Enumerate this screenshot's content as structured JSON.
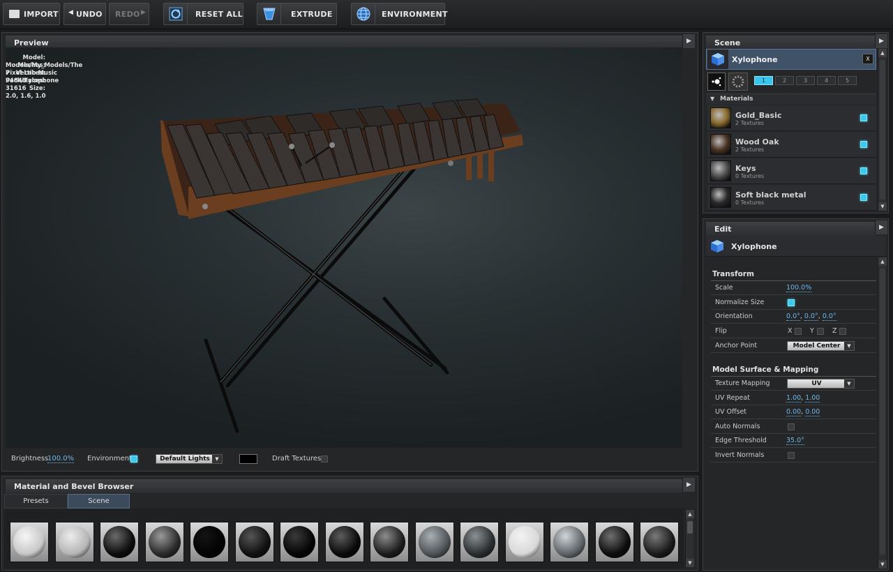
{
  "toolbar": {
    "import": "IMPORT",
    "undo": "UNDO",
    "redo": "REDO",
    "reset_all": "RESET ALL",
    "extrude": "EXTRUDE",
    "environment": "ENVIRONMENT"
  },
  "preview": {
    "title": "Preview",
    "info": [
      {
        "key": "Model:",
        "value": "Models/My_Models/The Pixel Lab Music Pack/Xylophone"
      },
      {
        "key": "Meshes:",
        "value": "7"
      },
      {
        "key": "Vertices:",
        "value": "94848"
      },
      {
        "key": "Faces:",
        "value": "31616"
      },
      {
        "key": "Size:",
        "value": "2.0, 1.6, 1.0"
      }
    ],
    "brightness_label": "Brightness",
    "brightness_value": "100.0%",
    "environment_label": "Environment",
    "environment_checked": true,
    "lights_select": "Default Lights",
    "draft_label": "Draft Textures",
    "draft_checked": false
  },
  "browser": {
    "title": "Material and Bevel Browser",
    "tabs": [
      "Presets",
      "Scene"
    ],
    "active_tab": "Scene",
    "swatches": [
      {
        "name": "swatch-1",
        "base": "#c8c8c8",
        "hi": "#f6f6f6"
      },
      {
        "name": "swatch-2",
        "base": "#b5b5b5",
        "hi": "#ececec"
      },
      {
        "name": "swatch-3",
        "base": "#0c0c0c",
        "hi": "#6a6a6a"
      },
      {
        "name": "swatch-4",
        "base": "#2a2a2a",
        "hi": "#9a9a9a"
      },
      {
        "name": "swatch-5",
        "base": "#020202",
        "hi": "#141414"
      },
      {
        "name": "swatch-6",
        "base": "#111111",
        "hi": "#555555"
      },
      {
        "name": "swatch-7",
        "base": "#050505",
        "hi": "#3a3a3a"
      },
      {
        "name": "swatch-8",
        "base": "#0a0a0a",
        "hi": "#5c5c5c"
      },
      {
        "name": "swatch-9",
        "base": "#1c1c1c",
        "hi": "#8d8d8d"
      },
      {
        "name": "swatch-10",
        "base": "#4d5356",
        "hi": "#a9b0b3"
      },
      {
        "name": "swatch-11",
        "base": "#2a2d2f",
        "hi": "#8a9194"
      },
      {
        "name": "swatch-12",
        "base": "#d9d9d9",
        "hi": "#f2f2f2"
      },
      {
        "name": "swatch-13",
        "base": "#5d6366",
        "hi": "#d0d6d9"
      },
      {
        "name": "swatch-14",
        "base": "#0d0d0d",
        "hi": "#6f6f6f"
      },
      {
        "name": "swatch-15",
        "base": "#1a1a1a",
        "hi": "#7a7a7a"
      }
    ]
  },
  "scene": {
    "title": "Scene",
    "object_name": "Xylophone",
    "close": "X",
    "number_tabs": [
      "1",
      "2",
      "3",
      "4",
      "5"
    ],
    "active_number": "1",
    "materials_label": "Materials",
    "materials": [
      {
        "name": "Gold_Basic",
        "sub": "2 Textures",
        "checked": true,
        "thumb": "#8a6a2c"
      },
      {
        "name": "Wood Oak",
        "sub": "2 Textures",
        "checked": true,
        "thumb": "#4b3423"
      },
      {
        "name": "Keys",
        "sub": "0 Textures",
        "checked": true,
        "thumb": "#4d4d4d"
      },
      {
        "name": "Soft black metal",
        "sub": "0 Textures",
        "checked": true,
        "thumb": "#2a2a2a"
      }
    ]
  },
  "edit": {
    "title": "Edit",
    "object_name": "Xylophone",
    "transform_label": "Transform",
    "surface_label": "Model Surface & Mapping",
    "scale_label": "Scale",
    "scale_value": "100.0%",
    "normalize_label": "Normalize Size",
    "normalize_checked": true,
    "orientation_label": "Orientation",
    "orientation": [
      "0.0°",
      "0.0°",
      "0.0°"
    ],
    "flip_label": "Flip",
    "flip_axes": [
      "X",
      "Y",
      "Z"
    ],
    "anchor_label": "Anchor Point",
    "anchor_value": "Model Center",
    "texture_mapping_label": "Texture Mapping",
    "texture_mapping_value": "UV",
    "uv_repeat_label": "UV Repeat",
    "uv_repeat": [
      "1.00",
      "1.00"
    ],
    "uv_offset_label": "UV Offset",
    "uv_offset": [
      "0.00",
      "0.00"
    ],
    "auto_normals_label": "Auto Normals",
    "edge_threshold_label": "Edge Threshold",
    "edge_threshold_value": "35.0°",
    "invert_normals_label": "Invert Normals"
  },
  "colors": {
    "accent": "#3bc9ee",
    "link": "#6fb7e9",
    "panel": "#252628"
  },
  "icons": {
    "import": "folder-icon",
    "undo": "undo-arrow-icon",
    "redo": "redo-arrow-icon",
    "reset": "reset-circle-icon",
    "extrude": "extrude-icon",
    "environment": "globe-icon",
    "object": "cube-icon"
  }
}
